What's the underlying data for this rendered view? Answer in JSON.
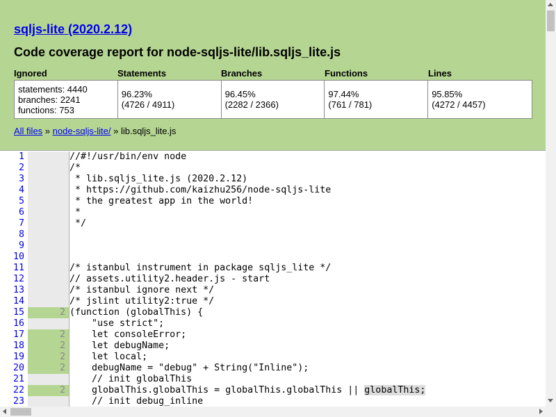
{
  "header": {
    "title_link": "sqljs-lite (2020.2.12)",
    "subtitle": "Code coverage report for node-sqljs-lite/lib.sqljs_lite.js"
  },
  "summary": {
    "ignored": {
      "label": "Ignored",
      "line1": "statements: 4440",
      "line2": "branches: 2241",
      "line3": "functions: 753"
    },
    "statements": {
      "label": "Statements",
      "pct": "96.23%",
      "ratio": "(4726 / 4911)"
    },
    "branches": {
      "label": "Branches",
      "pct": "96.45%",
      "ratio": "(2282 / 2366)"
    },
    "functions": {
      "label": "Functions",
      "pct": "97.44%",
      "ratio": "(761 / 781)"
    },
    "lines": {
      "label": "Lines",
      "pct": "95.85%",
      "ratio": "(4272 / 4457)"
    }
  },
  "breadcrumb": {
    "all_files": "All files",
    "sep1": " » ",
    "folder": "node-sqljs-lite/",
    "sep2": " » ",
    "file": "lib.sqljs_lite.js"
  },
  "code": [
    {
      "n": "1",
      "c": "",
      "s": "//#!/usr/bin/env node"
    },
    {
      "n": "2",
      "c": "",
      "s": "/*"
    },
    {
      "n": "3",
      "c": "",
      "s": " * lib.sqljs_lite.js (2020.2.12)"
    },
    {
      "n": "4",
      "c": "",
      "s": " * https://github.com/kaizhu256/node-sqljs-lite"
    },
    {
      "n": "5",
      "c": "",
      "s": " * the greatest app in the world!"
    },
    {
      "n": "6",
      "c": "",
      "s": " *"
    },
    {
      "n": "7",
      "c": "",
      "s": " */"
    },
    {
      "n": "8",
      "c": "",
      "s": ""
    },
    {
      "n": "9",
      "c": "",
      "s": ""
    },
    {
      "n": "10",
      "c": "",
      "s": ""
    },
    {
      "n": "11",
      "c": "",
      "s": "/* istanbul instrument in package sqljs_lite */"
    },
    {
      "n": "12",
      "c": "",
      "s": "// assets.utility2.header.js - start"
    },
    {
      "n": "13",
      "c": "",
      "s": "/* istanbul ignore next */"
    },
    {
      "n": "14",
      "c": "",
      "s": "/* jslint utility2:true */"
    },
    {
      "n": "15",
      "c": "2",
      "s": "(function (globalThis) {"
    },
    {
      "n": "16",
      "c": "",
      "s": "    \"use strict\";"
    },
    {
      "n": "17",
      "c": "2",
      "s": "    let consoleError;"
    },
    {
      "n": "18",
      "c": "2",
      "s": "    let debugName;"
    },
    {
      "n": "19",
      "c": "2",
      "s": "    let local;"
    },
    {
      "n": "20",
      "c": "2",
      "s": "    debugName = \"debug\" + String(\"Inline\");"
    },
    {
      "n": "21",
      "c": "",
      "s": "    // init globalThis"
    },
    {
      "n": "22",
      "c": "2",
      "s": "    globalThis.globalThis = globalThis.globalThis || ",
      "hl": "globalThis;"
    },
    {
      "n": "23",
      "c": "",
      "s": "    // init debug_inline"
    }
  ]
}
